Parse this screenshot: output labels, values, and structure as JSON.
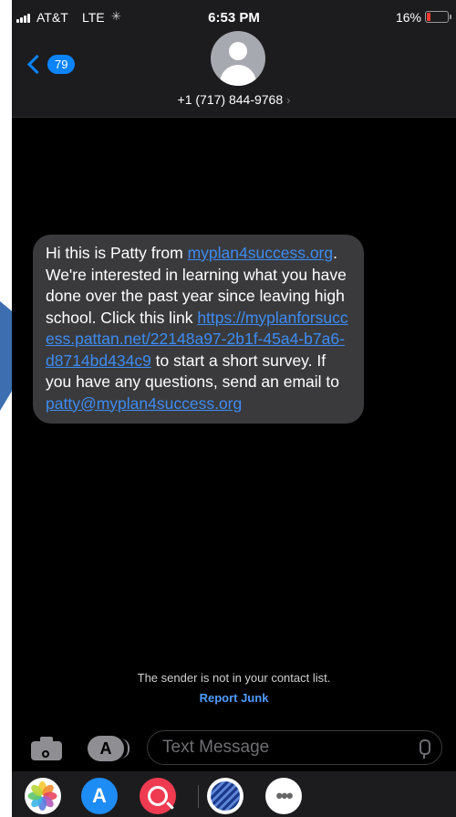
{
  "status_bar": {
    "carrier": "AT&T",
    "network": "LTE",
    "time": "6:53 PM",
    "battery_percent": "16%"
  },
  "header": {
    "unread_count": "79",
    "contact_number": "+1 (717) 844-9768"
  },
  "message": {
    "text_1": "Hi this is Patty from ",
    "link_1": "myplan4success.org",
    "text_2": ". We're interested in learning what you have done over the past year since leaving high school. Click this link ",
    "link_2": "https://myplanforsuccess.pattan.net/22148a97-2b1f-45a4-b7a6-d8714bd434c9",
    "text_3": " to start a short survey. If you have any questions, send an email to ",
    "link_3": "patty@myplan4success.org"
  },
  "footer": {
    "sender_note": "The sender is not in your contact list.",
    "report_junk": "Report Junk"
  },
  "compose": {
    "placeholder": "Text Message"
  },
  "colors": {
    "accent_blue": "#0a84ff",
    "link_blue": "#3c8cf4",
    "bubble_gray": "#3a3a3c",
    "background": "#000000",
    "arrow_blue": "#3d6fb0"
  },
  "icons": {
    "photos": "photos-app-icon",
    "app_store": "app-store-icon",
    "search": "image-search-app-icon",
    "united": "united-airlines-icon",
    "more": "more-apps-icon"
  }
}
